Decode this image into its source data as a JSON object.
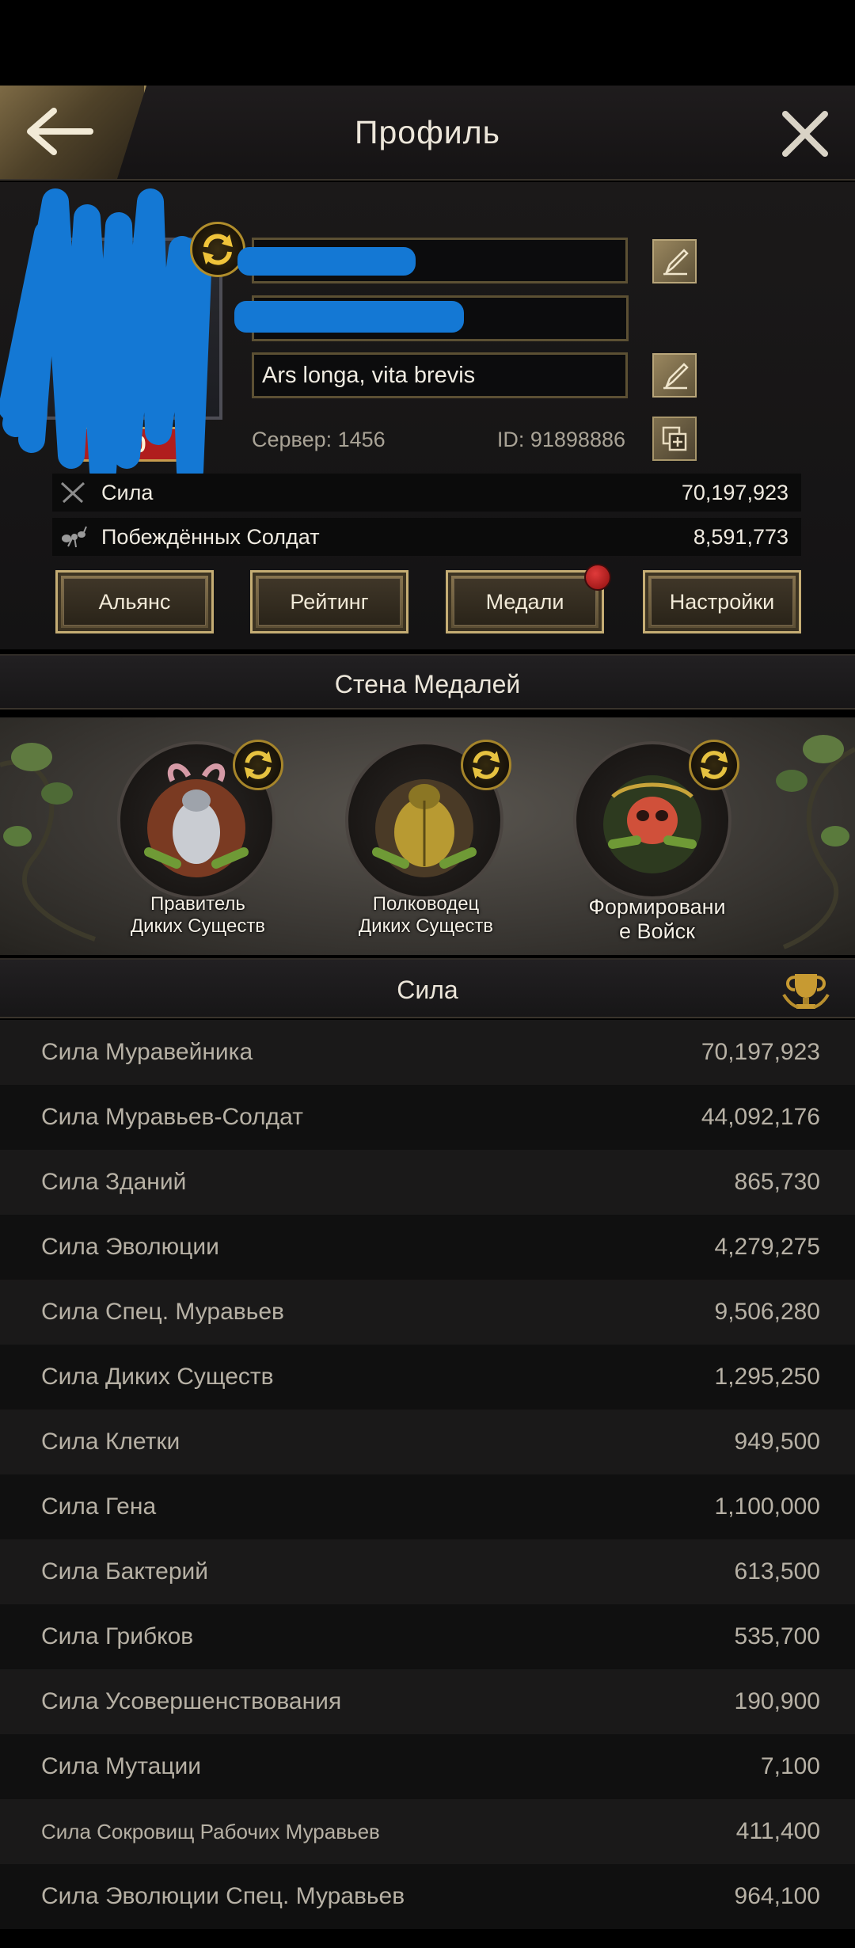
{
  "header": {
    "title": "Профиль",
    "back_icon": "arrow-left-icon",
    "close_icon": "close-icon"
  },
  "profile": {
    "level": "10",
    "motto": "Ars longa, vita brevis",
    "server": "Сервер: 1456",
    "id": "ID: 91898886",
    "stats": {
      "power_label": "Сила",
      "power_value": "70,197,923",
      "soldiers_label": "Побеждённых Солдат",
      "soldiers_value": "8,591,773"
    },
    "tabs": {
      "alliance": "Альянс",
      "rating": "Рейтинг",
      "medals": "Медали",
      "settings": "Настройки"
    }
  },
  "medal_wall": {
    "title": "Стена Медалей",
    "medals": [
      {
        "caption": "Правитель Диких Существ",
        "line1": "Правитель",
        "line2": "Диких Существ"
      },
      {
        "caption": "Полководец Диких Существ",
        "line1": "Полководец",
        "line2": "Диких Существ"
      },
      {
        "caption": "Формировани е Войск",
        "line1": "Формировани",
        "line2": "е Войск"
      }
    ]
  },
  "power_section": {
    "title": "Сила",
    "rows": [
      {
        "label": "Сила Муравейника",
        "value": "70,197,923"
      },
      {
        "label": "Сила Муравьев-Солдат",
        "value": "44,092,176"
      },
      {
        "label": "Сила Зданий",
        "value": "865,730"
      },
      {
        "label": "Сила Эволюции",
        "value": "4,279,275"
      },
      {
        "label": "Сила Спец. Муравьев",
        "value": "9,506,280"
      },
      {
        "label": "Сила Диких Существ",
        "value": "1,295,250"
      },
      {
        "label": "Сила Клетки",
        "value": "949,500"
      },
      {
        "label": "Сила Гена",
        "value": "1,100,000"
      },
      {
        "label": "Сила Бактерий",
        "value": "613,500"
      },
      {
        "label": "Сила Грибков",
        "value": "535,700"
      },
      {
        "label": "Сила Усовершенствования",
        "value": "190,900"
      },
      {
        "label": "Сила Мутации",
        "value": "7,100"
      },
      {
        "label": "Сила Сокровищ Рабочих Муравьев",
        "value": "411,400"
      },
      {
        "label": "Сила Эволюции Спец. Муравьев",
        "value": "964,100"
      }
    ]
  },
  "colors": {
    "accent_gold": "#c5ad74",
    "redaction_blue": "#1478d4",
    "badge_red": "#b01d1d"
  }
}
